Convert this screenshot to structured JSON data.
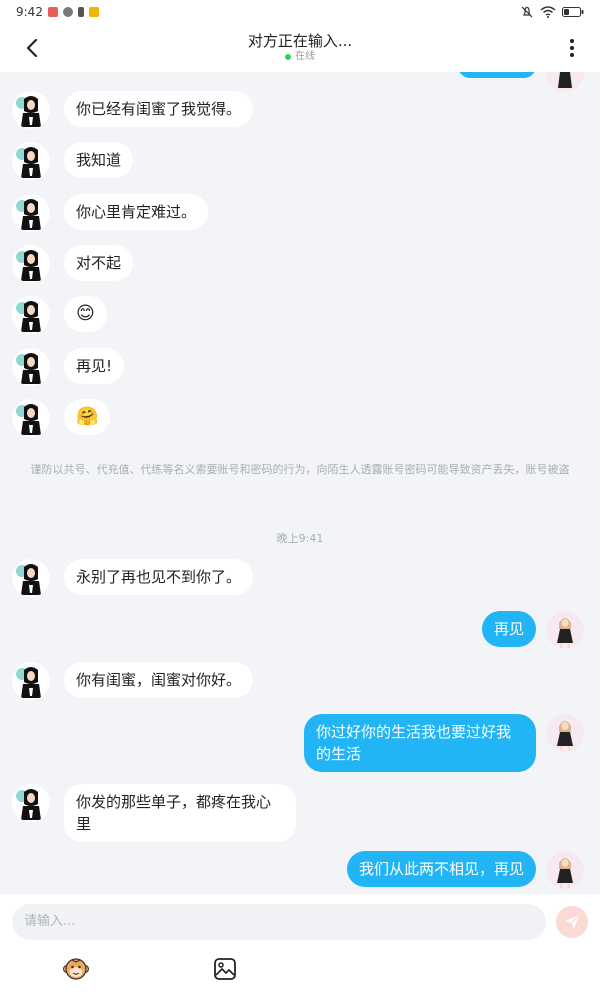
{
  "status_bar": {
    "time": "9:42"
  },
  "header": {
    "title": "对方正在输入...",
    "status": "在线"
  },
  "messages_top": [
    {
      "text": "你已经有闺蜜了我觉得。"
    },
    {
      "text": "我知道"
    },
    {
      "text": "你心里肯定难过。"
    },
    {
      "text": "对不起"
    },
    {
      "text": "😊"
    },
    {
      "text": "再见!"
    },
    {
      "text": "🤗"
    }
  ],
  "notice": "谨防以共号、代充值、代练等名义索要账号和密码的行为，向陌生人透露账号密码可能导致资产丢失，账号被盗",
  "timestamp": "晚上9:41",
  "messages_bottom": [
    {
      "side": "left",
      "text": "永别了再也见不到你了。"
    },
    {
      "side": "right",
      "text": "再见"
    },
    {
      "side": "left",
      "text": "你有闺蜜，闺蜜对你好。"
    },
    {
      "side": "right",
      "text": "你过好你的生活我也要过好我的生活"
    },
    {
      "side": "left",
      "text": "你发的那些单子，都疼在我心里"
    },
    {
      "side": "right",
      "text": "我们从此两不相见，再见"
    }
  ],
  "composer": {
    "placeholder": "请输入..."
  },
  "colors": {
    "accent": "#22b5f5",
    "background": "#f3f4f8",
    "send_button": "#fbd9d4",
    "online_dot": "#2fcf5a"
  },
  "icons": {
    "back": "chevron-left-icon",
    "more": "more-vertical-icon",
    "send": "paper-plane-icon",
    "sticker": "monkey-face-icon",
    "image": "image-icon"
  }
}
